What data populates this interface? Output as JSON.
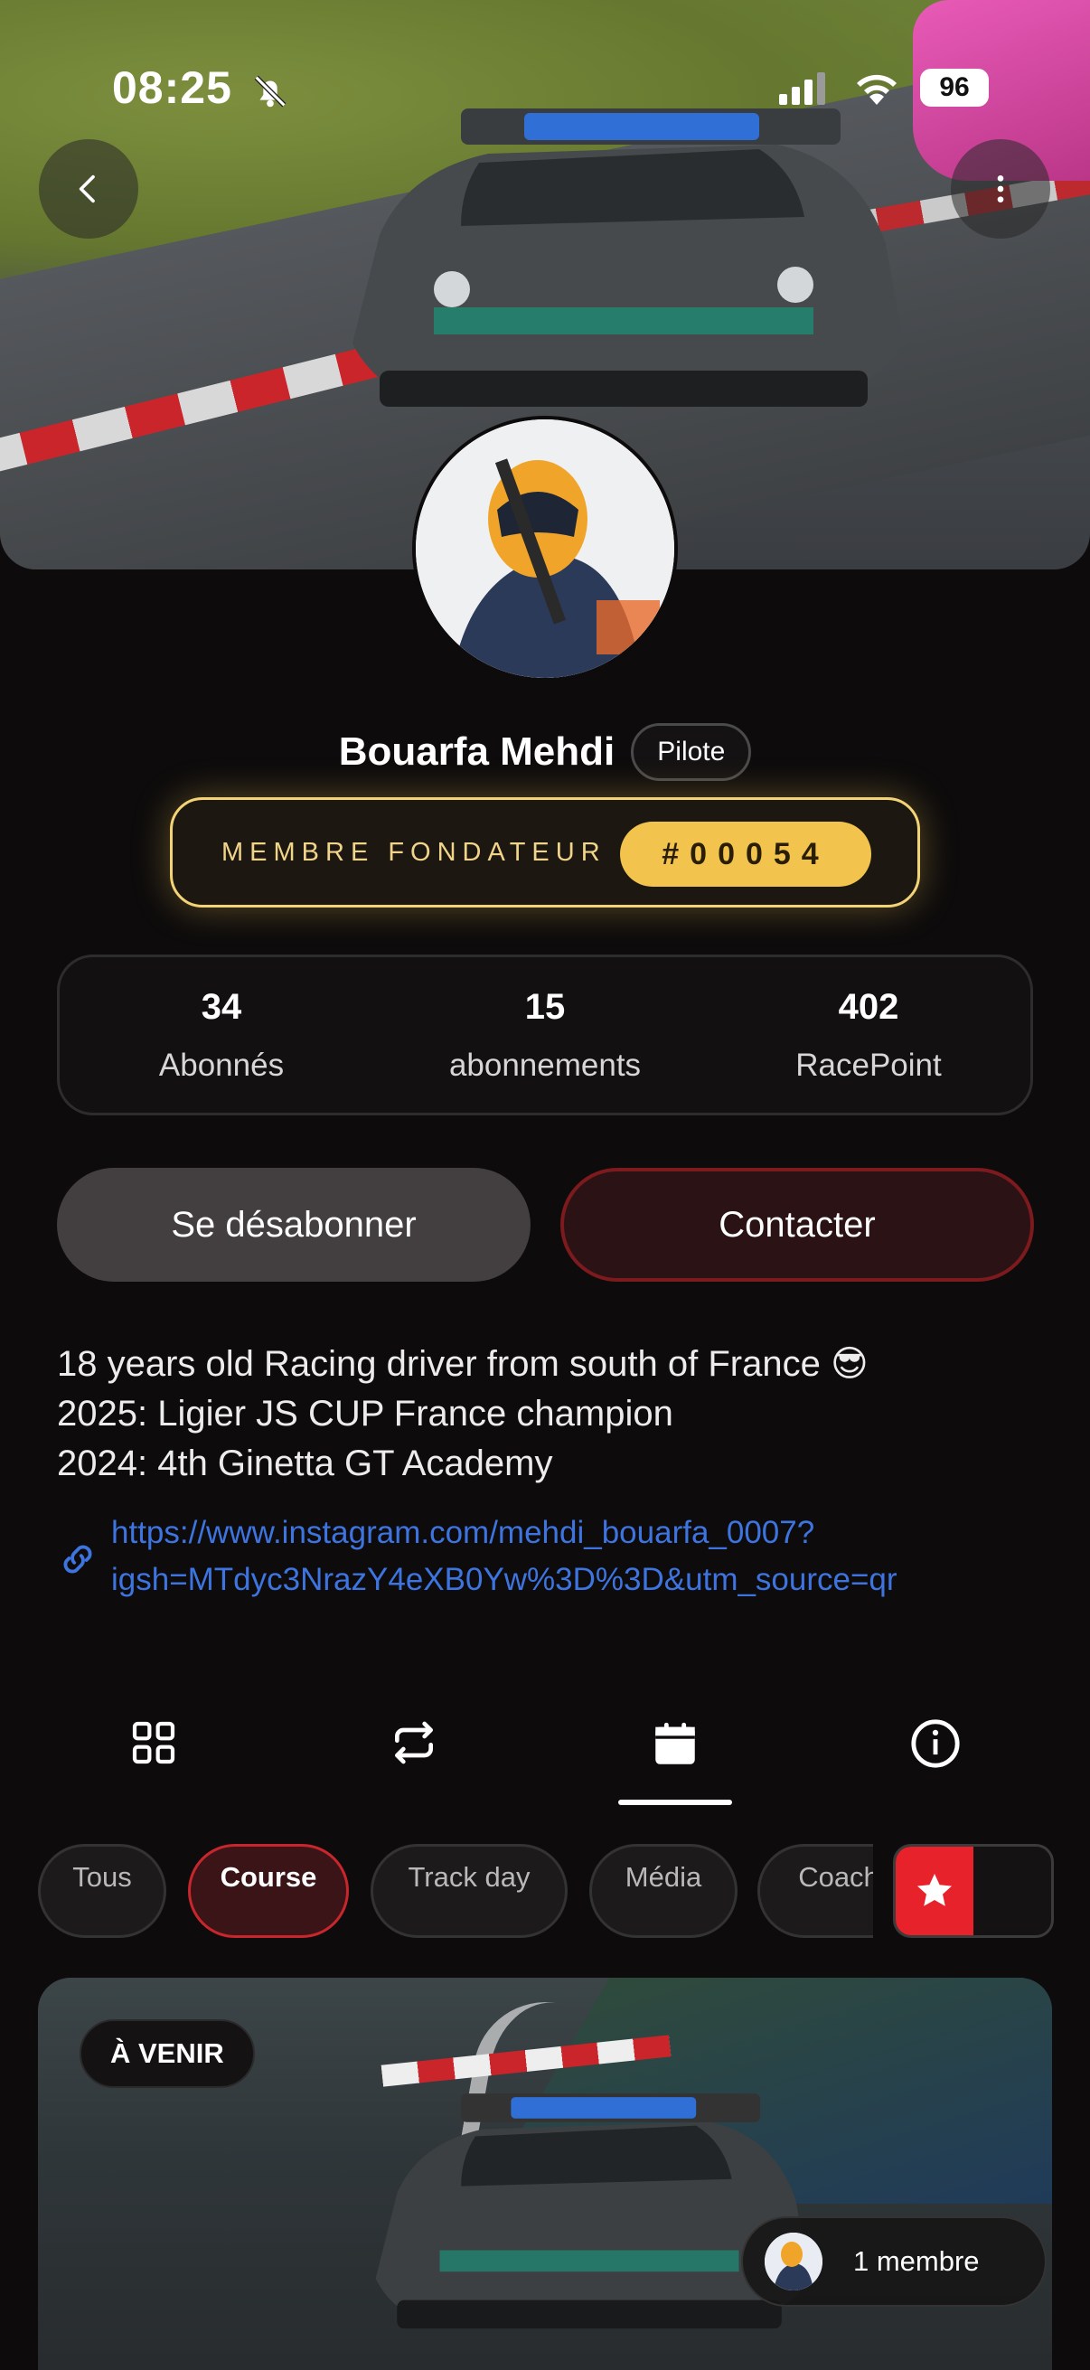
{
  "status_bar": {
    "time": "08:25",
    "battery": "96"
  },
  "profile": {
    "name": "Bouarfa Mehdi",
    "role": "Pilote",
    "founder_label": "MEMBRE FONDATEUR",
    "founder_number": "#00054"
  },
  "stats": [
    {
      "value": "34",
      "label": "Abonnés"
    },
    {
      "value": "15",
      "label": "abonnements"
    },
    {
      "value": "402",
      "label": "RacePoint"
    }
  ],
  "actions": {
    "unsubscribe_label": "Se désabonner",
    "contact_label": "Contacter"
  },
  "bio": {
    "lines": [
      "18 years old Racing driver from south of France 😎",
      "2025: Ligier JS CUP France champion",
      "2024: 4th Ginetta GT Academy"
    ],
    "link_lines": [
      "https://www.instagram.com/mehdi_bouarfa_0007?",
      "igsh=MTdyc3NrazY4eXB0Yw%3D%3D&utm_source=qr"
    ]
  },
  "tabs": [
    {
      "icon": "grid-icon"
    },
    {
      "icon": "repost-icon"
    },
    {
      "icon": "calendar-icon",
      "active": true
    },
    {
      "icon": "info-icon"
    }
  ],
  "filters": {
    "chips": [
      "Tous",
      "Course",
      "Track day",
      "Média",
      "Coach"
    ],
    "active": "Course"
  },
  "event": {
    "badge": "À VENIR",
    "members": "1 membre"
  },
  "colors": {
    "background": "#0d0b0c",
    "founder_gold": "#f2c44e",
    "accent_red": "#c8262c",
    "link_blue": "#3d74e0"
  }
}
